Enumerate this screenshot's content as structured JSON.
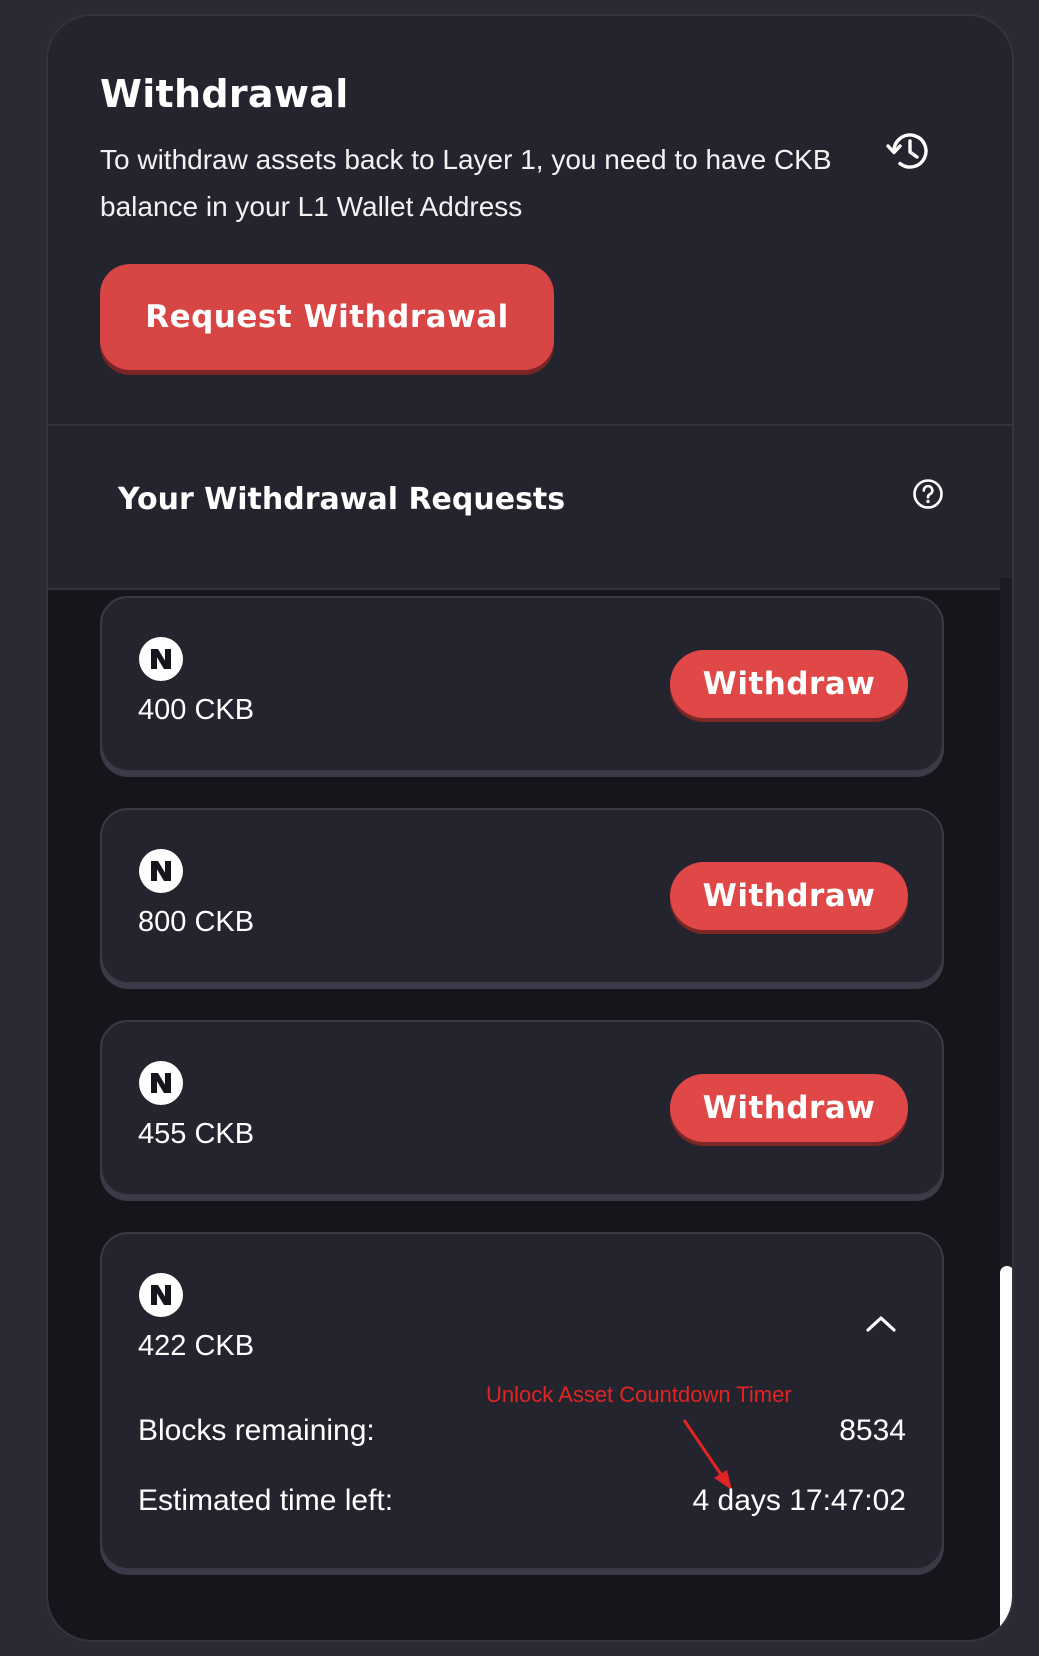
{
  "withdrawal": {
    "title": "Withdrawal",
    "description": "To withdraw assets back to Layer 1, you need to have CKB balance in your L1 Wallet Address",
    "request_button_label": "Request Withdrawal",
    "history_icon": "history-icon"
  },
  "requests": {
    "title": "Your Withdrawal Requests",
    "help_icon": "help-circle-icon",
    "items": [
      {
        "amount": "400 CKB",
        "action_label": "Withdraw",
        "icon": "nervos-token-icon"
      },
      {
        "amount": "800 CKB",
        "action_label": "Withdraw",
        "icon": "nervos-token-icon"
      },
      {
        "amount": "455 CKB",
        "action_label": "Withdraw",
        "icon": "nervos-token-icon"
      }
    ],
    "expanded_item": {
      "amount": "422 CKB",
      "icon": "nervos-token-icon",
      "collapse_icon": "chevron-up-icon",
      "blocks_label": "Blocks remaining:",
      "blocks_value": "8534",
      "time_label": "Estimated time left:",
      "time_value": "4 days 17:47:02",
      "annotation": "Unlock Asset Countdown Timer"
    }
  },
  "colors": {
    "accent": "#e04747",
    "card_background": "#24242f",
    "page_background": "#15151c",
    "annotation": "#e02424"
  }
}
